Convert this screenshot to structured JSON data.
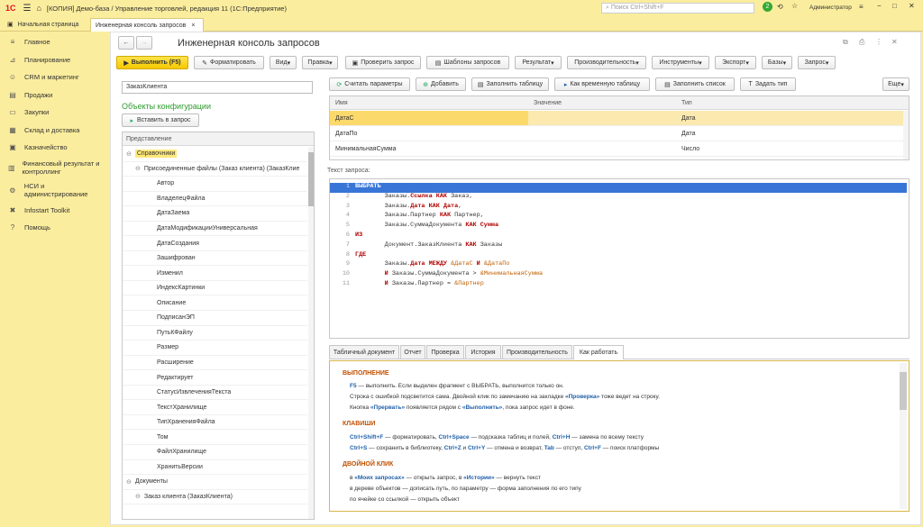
{
  "titlebar": {
    "logo": "1С",
    "title": "[КОПИЯ] Демо-база / Управление торговлей, редакция 11  (1С:Предприятие)",
    "search_placeholder": "Поиск Ctrl+Shift+F",
    "notif_count": "2",
    "user": "Администратор"
  },
  "tabs": {
    "home": "Начальная страница",
    "active": "Инженерная консоль запросов"
  },
  "sidebar": [
    {
      "label": "Главное",
      "icon": "≡"
    },
    {
      "label": "Планирование",
      "icon": "⊿"
    },
    {
      "label": "CRM и маркетинг",
      "icon": "☺"
    },
    {
      "label": "Продажи",
      "icon": "▤"
    },
    {
      "label": "Закупки",
      "icon": "▭"
    },
    {
      "label": "Склад и доставка",
      "icon": "▦"
    },
    {
      "label": "Казначейство",
      "icon": "▣"
    },
    {
      "label": "Финансовый результат и контроллинг",
      "icon": "▥"
    },
    {
      "label": "НСИ и администрирование",
      "icon": "⚙"
    },
    {
      "label": "Infostart Toolkit",
      "icon": "✖"
    },
    {
      "label": "Помощь",
      "icon": "?"
    }
  ],
  "form": {
    "title": "Инженерная консоль запросов"
  },
  "toolbar": {
    "execute": "Выполнить (F5)",
    "format": "Форматировать",
    "view": "Вид",
    "edit": "Правка",
    "check": "Проверить запрос",
    "templates": "Шаблоны запросов",
    "result": "Результат",
    "performance": "Производительность",
    "tools": "Инструменты",
    "export": "Экспорт",
    "bases": "Базы",
    "query": "Запрос"
  },
  "left": {
    "search_value": "ЗаказКлиента",
    "objects_title": "Объекты конфигурации",
    "insert": "Вставить в запрос",
    "tree_header": "Представление",
    "tree": [
      {
        "label": "Справочники",
        "indent": 0,
        "sel": true,
        "exp": "⊖"
      },
      {
        "label": "Присоединенные файлы (Заказ клиента) (ЗаказКлие",
        "indent": 1,
        "exp": "⊖"
      },
      {
        "label": "Автор",
        "indent": 2
      },
      {
        "label": "ВладелецФайла",
        "indent": 2
      },
      {
        "label": "ДатаЗаема",
        "indent": 2
      },
      {
        "label": "ДатаМодификацииУниверсальная",
        "indent": 2
      },
      {
        "label": "ДатаСоздания",
        "indent": 2
      },
      {
        "label": "Зашифрован",
        "indent": 2
      },
      {
        "label": "Изменил",
        "indent": 2
      },
      {
        "label": "ИндексКартинки",
        "indent": 2
      },
      {
        "label": "Описание",
        "indent": 2
      },
      {
        "label": "ПодписанЭП",
        "indent": 2
      },
      {
        "label": "ПутьКФайлу",
        "indent": 2
      },
      {
        "label": "Размер",
        "indent": 2
      },
      {
        "label": "Расширение",
        "indent": 2
      },
      {
        "label": "Редактирует",
        "indent": 2
      },
      {
        "label": "СтатусИзвлеченияТекста",
        "indent": 2
      },
      {
        "label": "ТекстХранилище",
        "indent": 2
      },
      {
        "label": "ТипХраненияФайла",
        "indent": 2
      },
      {
        "label": "Том",
        "indent": 2
      },
      {
        "label": "ФайлХранилище",
        "indent": 2
      },
      {
        "label": "ХранитьВерсии",
        "indent": 2
      },
      {
        "label": "Документы",
        "indent": 0,
        "exp": "⊖"
      },
      {
        "label": "Заказ клиента (ЗаказКлиента)",
        "indent": 1,
        "exp": "⊖"
      }
    ]
  },
  "params": {
    "read_params": "Считать параметры",
    "add": "Добавить",
    "fill_table": "Заполнить таблицу",
    "as_temp": "Как временную таблицу",
    "fill_list": "Заполнить список",
    "set_type": "Задать тип",
    "more": "Еще",
    "cols": [
      "Имя",
      "Значение",
      "Тип"
    ],
    "rows": [
      [
        "ДатаС",
        "",
        "Дата"
      ],
      [
        "ДатаПо",
        "",
        "Дата"
      ],
      [
        "МинимальнаяСумма",
        "",
        "Число"
      ]
    ]
  },
  "query_label": "Текст запроса:",
  "result_tabs": [
    "Табличный документ",
    "Отчет",
    "Проверка",
    "История",
    "Производительность",
    "Как работать"
  ],
  "help": {
    "h1": "ВЫПОЛНЕНИЕ",
    "l1": "<b>F5</b> — выполнить. Если выделен фрагмент с ВЫБРАТЬ, выполнится только он.",
    "l2": "Строка с ошибкой подсветится сама. Двойной клик по замечанию на закладке <b>«Проверка»</b> тоже ведет на строку.",
    "l3": "Кнопка <b>«Прервать»</b> появляется рядом с <b>«Выполнить»</b>, пока запрос идет в фоне.",
    "h2": "КЛАВИШИ",
    "l4": "<b>Ctrl+Shift+F</b> — форматировать, <b>Ctrl+Space</b> — подсказка таблиц и полей, <b>Ctrl+H</b> — замена по всему тексту",
    "l5": "<b>Ctrl+S</b> — сохранить в библиотеку, <b>Ctrl+Z</b> и <b>Ctrl+Y</b> — отмена и возврат, <b>Tab</b> — отступ, <b>Ctrl+F</b> — поиск платформы",
    "h3": "ДВОЙНОЙ КЛИК",
    "l6": "в <b>«Моих запросах»</b> — открыть запрос, в <b>«Истории»</b> — вернуть текст",
    "l7": "в дереве объектов — дописать путь, по параметру — форма заполнения по его типу",
    "l8": "по ячейке со ссылкой — открыть объект"
  },
  "code": [
    {
      "n": "1",
      "html": "<span class='kw'>ВЫБРАТЬ</span>"
    },
    {
      "n": "2",
      "html": "        Заказы.<span class='kw'>Ссылка КАК</span> Заказ,"
    },
    {
      "n": "3",
      "html": "        Заказы.<span class='kw'>Дата КАК Дата</span>,"
    },
    {
      "n": "4",
      "html": "        Заказы.Партнер <span class='kw'>КАК</span> Партнер,"
    },
    {
      "n": "5",
      "html": "        Заказы.СуммаДокумента <span class='kw'>КАК Сумма</span>"
    },
    {
      "n": "6",
      "html": "<span class='kw'>ИЗ</span>"
    },
    {
      "n": "7",
      "html": "        Документ.ЗаказКлиента <span class='kw'>КАК</span> Заказы"
    },
    {
      "n": "8",
      "html": "<span class='kw'>ГДЕ</span>"
    },
    {
      "n": "9",
      "html": "        Заказы.<span class='kw'>Дата МЕЖДУ</span> <span class='par'>&amp;ДатаС</span> <span class='kw'>И</span> <span class='par'>&amp;ДатаПо</span>"
    },
    {
      "n": "10",
      "html": "        <span class='kw'>И</span> Заказы.СуммаДокумента &gt; <span class='par'>&amp;МинимальнаяСумма</span>"
    },
    {
      "n": "11",
      "html": "        <span class='kw'>И</span> Заказы.Партнер = <span class='par'>&amp;Партнер</span>"
    }
  ]
}
